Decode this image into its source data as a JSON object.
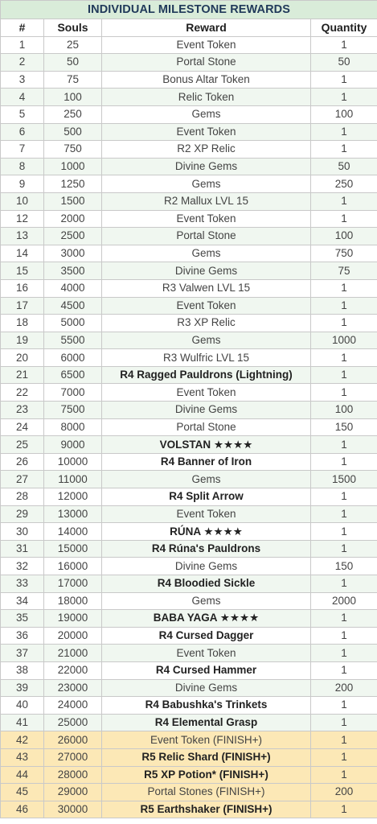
{
  "title": "INDIVIDUAL MILESTONE REWARDS",
  "headers": [
    "#",
    "Souls",
    "Reward",
    "Quantity"
  ],
  "rows": [
    {
      "num": "1",
      "souls": "25",
      "reward": "Event Token",
      "qty": "1",
      "bold": false,
      "finish": false
    },
    {
      "num": "2",
      "souls": "50",
      "reward": "Portal Stone",
      "qty": "50",
      "bold": false,
      "finish": false
    },
    {
      "num": "3",
      "souls": "75",
      "reward": "Bonus Altar Token",
      "qty": "1",
      "bold": false,
      "finish": false
    },
    {
      "num": "4",
      "souls": "100",
      "reward": "Relic Token",
      "qty": "1",
      "bold": false,
      "finish": false
    },
    {
      "num": "5",
      "souls": "250",
      "reward": "Gems",
      "qty": "100",
      "bold": false,
      "finish": false
    },
    {
      "num": "6",
      "souls": "500",
      "reward": "Event Token",
      "qty": "1",
      "bold": false,
      "finish": false
    },
    {
      "num": "7",
      "souls": "750",
      "reward": "R2 XP Relic",
      "qty": "1",
      "bold": false,
      "finish": false
    },
    {
      "num": "8",
      "souls": "1000",
      "reward": "Divine Gems",
      "qty": "50",
      "bold": false,
      "finish": false
    },
    {
      "num": "9",
      "souls": "1250",
      "reward": "Gems",
      "qty": "250",
      "bold": false,
      "finish": false
    },
    {
      "num": "10",
      "souls": "1500",
      "reward": "R2 Mallux LVL 15",
      "qty": "1",
      "bold": false,
      "finish": false
    },
    {
      "num": "12",
      "souls": "2000",
      "reward": "Event Token",
      "qty": "1",
      "bold": false,
      "finish": false
    },
    {
      "num": "13",
      "souls": "2500",
      "reward": "Portal Stone",
      "qty": "100",
      "bold": false,
      "finish": false
    },
    {
      "num": "14",
      "souls": "3000",
      "reward": "Gems",
      "qty": "750",
      "bold": false,
      "finish": false
    },
    {
      "num": "15",
      "souls": "3500",
      "reward": "Divine Gems",
      "qty": "75",
      "bold": false,
      "finish": false
    },
    {
      "num": "16",
      "souls": "4000",
      "reward": "R3 Valwen LVL 15",
      "qty": "1",
      "bold": false,
      "finish": false
    },
    {
      "num": "17",
      "souls": "4500",
      "reward": "Event Token",
      "qty": "1",
      "bold": false,
      "finish": false
    },
    {
      "num": "18",
      "souls": "5000",
      "reward": "R3 XP Relic",
      "qty": "1",
      "bold": false,
      "finish": false
    },
    {
      "num": "19",
      "souls": "5500",
      "reward": "Gems",
      "qty": "1000",
      "bold": false,
      "finish": false
    },
    {
      "num": "20",
      "souls": "6000",
      "reward": "R3 Wulfric LVL 15",
      "qty": "1",
      "bold": false,
      "finish": false
    },
    {
      "num": "21",
      "souls": "6500",
      "reward": "R4 Ragged Pauldrons (Lightning)",
      "qty": "1",
      "bold": true,
      "finish": false
    },
    {
      "num": "22",
      "souls": "7000",
      "reward": "Event Token",
      "qty": "1",
      "bold": false,
      "finish": false
    },
    {
      "num": "23",
      "souls": "7500",
      "reward": "Divine Gems",
      "qty": "100",
      "bold": false,
      "finish": false
    },
    {
      "num": "24",
      "souls": "8000",
      "reward": "Portal Stone",
      "qty": "150",
      "bold": false,
      "finish": false
    },
    {
      "num": "25",
      "souls": "9000",
      "reward": "VOLSTAN ★★★★",
      "qty": "1",
      "bold": true,
      "finish": false
    },
    {
      "num": "26",
      "souls": "10000",
      "reward": "R4 Banner of Iron",
      "qty": "1",
      "bold": true,
      "finish": false
    },
    {
      "num": "27",
      "souls": "11000",
      "reward": "Gems",
      "qty": "1500",
      "bold": false,
      "finish": false
    },
    {
      "num": "28",
      "souls": "12000",
      "reward": "R4 Split Arrow",
      "qty": "1",
      "bold": true,
      "finish": false
    },
    {
      "num": "29",
      "souls": "13000",
      "reward": "Event Token",
      "qty": "1",
      "bold": false,
      "finish": false
    },
    {
      "num": "30",
      "souls": "14000",
      "reward": "RÚNA ★★★★",
      "qty": "1",
      "bold": true,
      "finish": false
    },
    {
      "num": "31",
      "souls": "15000",
      "reward": "R4 Rúna's Pauldrons",
      "qty": "1",
      "bold": true,
      "finish": false
    },
    {
      "num": "32",
      "souls": "16000",
      "reward": "Divine Gems",
      "qty": "150",
      "bold": false,
      "finish": false
    },
    {
      "num": "33",
      "souls": "17000",
      "reward": "R4 Bloodied Sickle",
      "qty": "1",
      "bold": true,
      "finish": false
    },
    {
      "num": "34",
      "souls": "18000",
      "reward": "Gems",
      "qty": "2000",
      "bold": false,
      "finish": false
    },
    {
      "num": "35",
      "souls": "19000",
      "reward": "BABA YAGA ★★★★",
      "qty": "1",
      "bold": true,
      "finish": false
    },
    {
      "num": "36",
      "souls": "20000",
      "reward": "R4 Cursed Dagger",
      "qty": "1",
      "bold": true,
      "finish": false
    },
    {
      "num": "37",
      "souls": "21000",
      "reward": "Event Token",
      "qty": "1",
      "bold": false,
      "finish": false
    },
    {
      "num": "38",
      "souls": "22000",
      "reward": "R4 Cursed Hammer",
      "qty": "1",
      "bold": true,
      "finish": false
    },
    {
      "num": "39",
      "souls": "23000",
      "reward": "Divine Gems",
      "qty": "200",
      "bold": false,
      "finish": false
    },
    {
      "num": "40",
      "souls": "24000",
      "reward": "R4 Babushka's Trinkets",
      "qty": "1",
      "bold": true,
      "finish": false
    },
    {
      "num": "41",
      "souls": "25000",
      "reward": "R4 Elemental Grasp",
      "qty": "1",
      "bold": true,
      "finish": false
    },
    {
      "num": "42",
      "souls": "26000",
      "reward": "Event Token (FINISH+)",
      "qty": "1",
      "bold": false,
      "finish": true
    },
    {
      "num": "43",
      "souls": "27000",
      "reward": "R5 Relic Shard (FINISH+)",
      "qty": "1",
      "bold": true,
      "finish": true
    },
    {
      "num": "44",
      "souls": "28000",
      "reward": "R5 XP Potion* (FINISH+)",
      "qty": "1",
      "bold": true,
      "finish": true
    },
    {
      "num": "45",
      "souls": "29000",
      "reward": "Portal Stones (FINISH+)",
      "qty": "200",
      "bold": false,
      "finish": true
    },
    {
      "num": "46",
      "souls": "30000",
      "reward": "R5 Earthshaker (FINISH+)",
      "qty": "1",
      "bold": true,
      "finish": true
    }
  ]
}
